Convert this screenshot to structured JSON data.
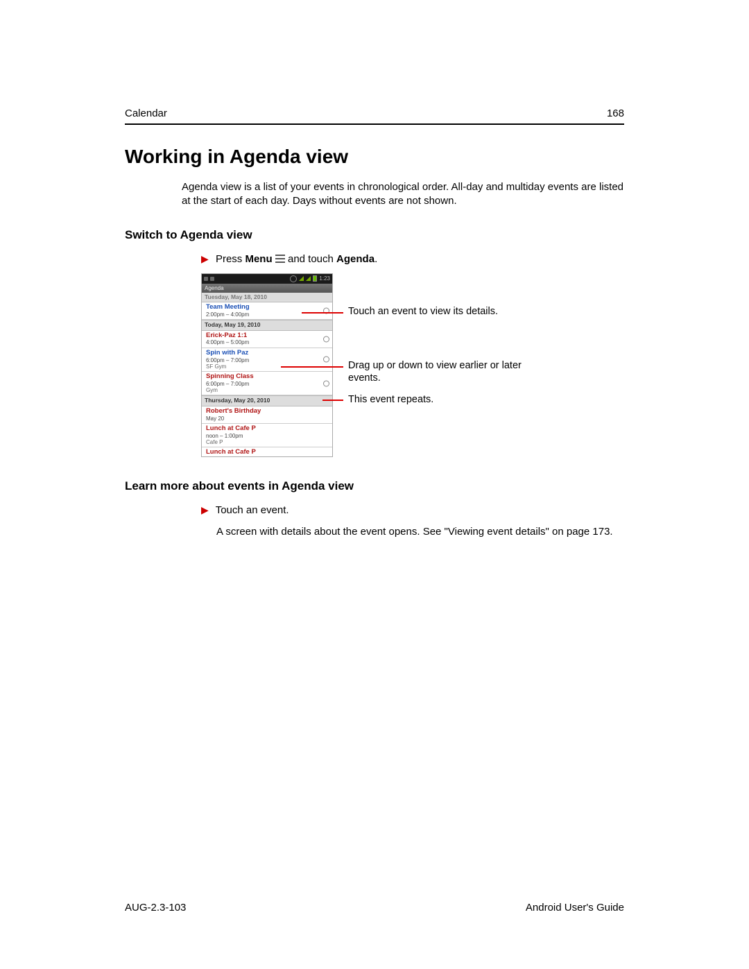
{
  "header": {
    "section": "Calendar",
    "page_no": "168"
  },
  "title": "Working in Agenda view",
  "intro": "Agenda view is a list of your events in chronological order. All-day and multiday events are listed at the start of each day. Days without events are not shown.",
  "switch": {
    "heading": "Switch to Agenda view",
    "press": "Press ",
    "menu": "Menu",
    "touch": " and touch ",
    "agenda": "Agenda",
    "period": "."
  },
  "phone": {
    "time": "1:23",
    "agenda_label": "Agenda",
    "prev_day": "Tuesday, May 18, 2010",
    "events": {
      "team": {
        "title": "Team Meeting",
        "time": "2:00pm – 4:00pm"
      },
      "day_today": "Today, May 19, 2010",
      "erick": {
        "title": "Erick-Paz 1:1",
        "time": "4:00pm – 5:00pm"
      },
      "spin": {
        "title": "Spin with Paz",
        "time": "6:00pm – 7:00pm",
        "loc": "SF Gym"
      },
      "spinclass": {
        "title": "Spinning Class",
        "time": "6:00pm – 7:00pm",
        "loc": "Gym"
      },
      "day_thu": "Thursday, May 20, 2010",
      "robert": {
        "title": "Robert's Birthday",
        "time": "May 20"
      },
      "lunch": {
        "title": "Lunch at Cafe P",
        "time": "noon – 1:00pm",
        "loc": "Cafe P"
      },
      "lunch2": {
        "title": "Lunch at Cafe P"
      }
    }
  },
  "callouts": {
    "c1": "Touch an event to view its details.",
    "c2": "Drag up or down to view earlier or later events.",
    "c3": "This event repeats."
  },
  "learn": {
    "heading": "Learn more about events in Agenda view",
    "step": "Touch an event.",
    "detail": "A screen with details about the event opens. See \"Viewing event details\" on page 173."
  },
  "footer": {
    "left": "AUG-2.3-103",
    "right": "Android User's Guide"
  }
}
